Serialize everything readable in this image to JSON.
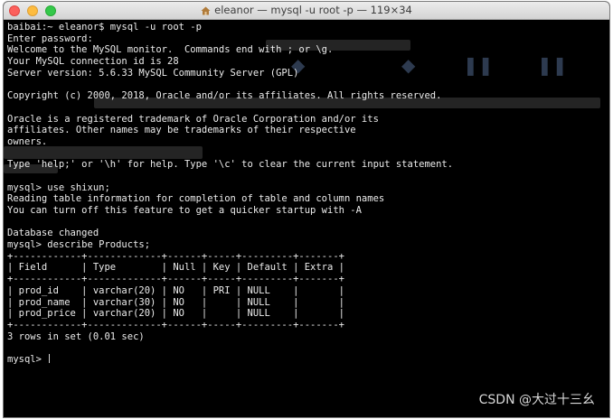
{
  "window": {
    "title": "eleanor — mysql -u root -p — 119×34"
  },
  "terminal": {
    "lines": [
      "baibai:~ eleanor$ mysql -u root -p",
      "Enter password:",
      "Welcome to the MySQL monitor.  Commands end with ; or \\g.",
      "Your MySQL connection id is 28",
      "Server version: 5.6.33 MySQL Community Server (GPL)",
      "",
      "Copyright (c) 2000, 2018, Oracle and/or its affiliates. All rights reserved.",
      "",
      "Oracle is a registered trademark of Oracle Corporation and/or its",
      "affiliates. Other names may be trademarks of their respective",
      "owners.",
      "",
      "Type 'help;' or '\\h' for help. Type '\\c' to clear the current input statement.",
      "",
      "mysql> use shixun;",
      "Reading table information for completion of table and column names",
      "You can turn off this feature to get a quicker startup with -A",
      "",
      "Database changed",
      "mysql> describe Products;",
      "+------------+-------------+------+-----+---------+-------+",
      "| Field      | Type        | Null | Key | Default | Extra |",
      "+------------+-------------+------+-----+---------+-------+",
      "| prod_id    | varchar(20) | NO   | PRI | NULL    |       |",
      "| prod_name  | varchar(30) | NO   |     | NULL    |       |",
      "| prod_price | varchar(20) | NO   |     | NULL    |       |",
      "+------------+-------------+------+-----+---------+-------+",
      "3 rows in set (0.01 sec)",
      "",
      "mysql> "
    ]
  },
  "watermark": "CSDN @大过十三幺",
  "colors": {
    "terminal_bg": "#000000",
    "terminal_fg": "#ececec",
    "close": "#fc605c",
    "minimize": "#fdbc40",
    "maximize": "#34c84a"
  }
}
